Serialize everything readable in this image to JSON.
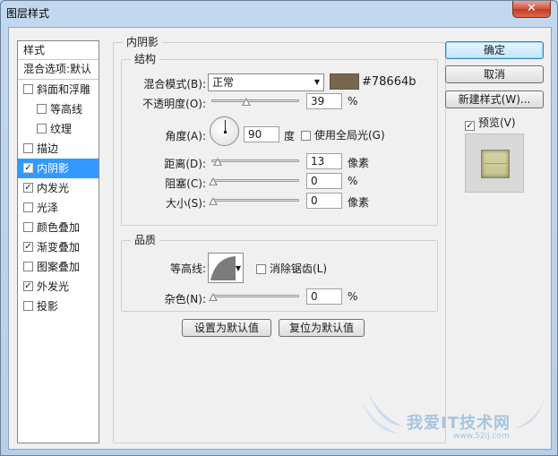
{
  "window": {
    "title": "图层样式",
    "close": "✕"
  },
  "style_list": {
    "header": "样式",
    "blend_options": "混合选项:默认",
    "items": [
      {
        "label": "斜面和浮雕",
        "checked": false,
        "indent": false,
        "selected": false
      },
      {
        "label": "等高线",
        "checked": false,
        "indent": true,
        "selected": false
      },
      {
        "label": "纹理",
        "checked": false,
        "indent": true,
        "selected": false
      },
      {
        "label": "描边",
        "checked": false,
        "indent": false,
        "selected": false
      },
      {
        "label": "内阴影",
        "checked": true,
        "indent": false,
        "selected": true
      },
      {
        "label": "内发光",
        "checked": true,
        "indent": false,
        "selected": false
      },
      {
        "label": "光泽",
        "checked": false,
        "indent": false,
        "selected": false
      },
      {
        "label": "颜色叠加",
        "checked": false,
        "indent": false,
        "selected": false
      },
      {
        "label": "渐变叠加",
        "checked": true,
        "indent": false,
        "selected": false
      },
      {
        "label": "图案叠加",
        "checked": false,
        "indent": false,
        "selected": false
      },
      {
        "label": "外发光",
        "checked": true,
        "indent": false,
        "selected": false
      },
      {
        "label": "投影",
        "checked": false,
        "indent": false,
        "selected": false
      }
    ]
  },
  "panel": {
    "title": "内阴影",
    "structure": {
      "title": "结构",
      "blend_mode_label": "混合模式(B):",
      "blend_mode_value": "正常",
      "color": "#78664b",
      "color_hex_label": "#78664b",
      "opacity_label": "不透明度(O):",
      "opacity_value": "39",
      "opacity_unit": "%",
      "opacity_level": 0.39,
      "angle_label": "角度(A):",
      "angle_value": "90",
      "angle_unit": "度",
      "global_light_label": "使用全局光(G)",
      "global_light_checked": false,
      "distance_label": "距离(D):",
      "distance_value": "13",
      "distance_unit": "像素",
      "distance_level": 0.05,
      "choke_label": "阻塞(C):",
      "choke_value": "0",
      "choke_unit": "%",
      "choke_level": 0,
      "size_label": "大小(S):",
      "size_value": "0",
      "size_unit": "像素",
      "size_level": 0
    },
    "quality": {
      "title": "品质",
      "contour_label": "等高线:",
      "antialias_label": "消除锯齿(L)",
      "antialias_checked": false,
      "noise_label": "杂色(N):",
      "noise_value": "0",
      "noise_unit": "%",
      "noise_level": 0
    },
    "set_default": "设置为默认值",
    "reset_default": "复位为默认值"
  },
  "buttons": {
    "ok": "确定",
    "cancel": "取消",
    "new_style": "新建样式(W)...",
    "preview_label": "预览(V)",
    "preview_checked": true
  },
  "watermark": {
    "text": "我爱IT技术网",
    "url": "www.52ij.com"
  }
}
